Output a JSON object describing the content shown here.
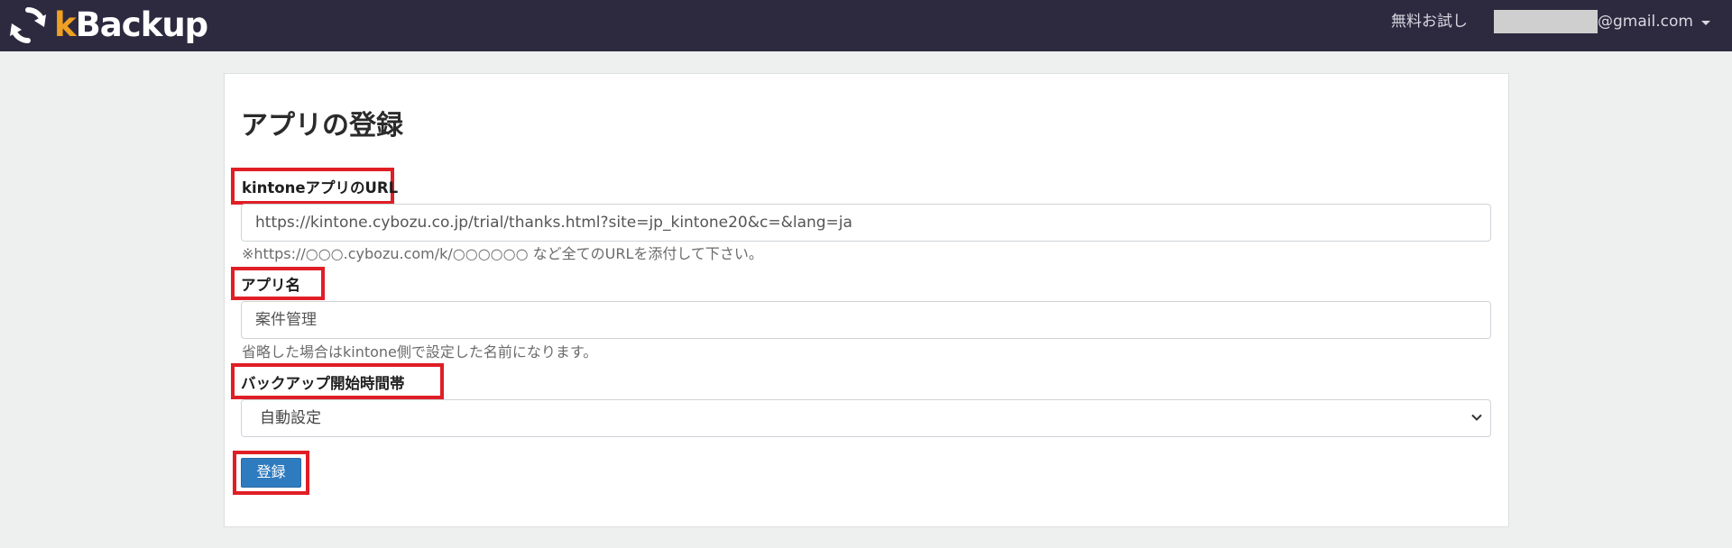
{
  "header": {
    "logo": {
      "k": "k",
      "rest": "Backup"
    },
    "free_trial_label": "無料お試し",
    "user_email_domain": "@gmail.com"
  },
  "page": {
    "title": "アプリの登録"
  },
  "form": {
    "url": {
      "label": "kintoneアプリのURL",
      "value": "https://kintone.cybozu.co.jp/trial/thanks.html?site=jp_kintone20&c=&lang=ja",
      "help": "※https://○○○.cybozu.com/k/○○○○○○ など全てのURLを添付して下さい。"
    },
    "app_name": {
      "label": "アプリ名",
      "value": "案件管理",
      "help": "省略した場合はkintone側で設定した名前になります。"
    },
    "backup_time": {
      "label": "バックアップ開始時間帯",
      "selected": "自動設定"
    },
    "submit_label": "登録"
  },
  "colors": {
    "navbar": "#2d2a40",
    "logo_accent": "#f0a022",
    "highlight": "#e01e26",
    "primary_button": "#2f7bbf"
  }
}
